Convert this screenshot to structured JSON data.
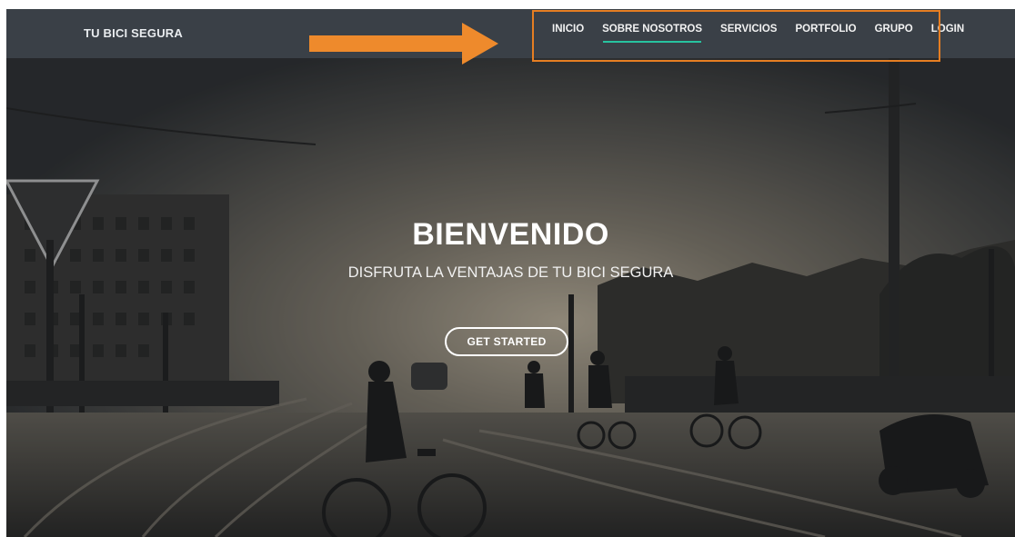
{
  "brand": "TU BICI SEGURA",
  "nav": {
    "items": [
      {
        "label": "INICIO"
      },
      {
        "label": "SOBRE NOSOTROS"
      },
      {
        "label": "SERVICIOS"
      },
      {
        "label": "PORTFOLIO"
      },
      {
        "label": "GRUPO"
      },
      {
        "label": "LOGIN"
      }
    ],
    "active_index": 1
  },
  "hero": {
    "title": "BIENVENIDO",
    "subtitle": "DISFRUTA LA VENTAJAS DE TU BICI SEGURA",
    "cta_label": "GET STARTED"
  },
  "colors": {
    "navbar_bg": "#3a4047",
    "active_underline": "#27c3a0",
    "annotation": "#e67e22"
  },
  "icons": {
    "annotation_arrow": "right-arrow-icon"
  }
}
